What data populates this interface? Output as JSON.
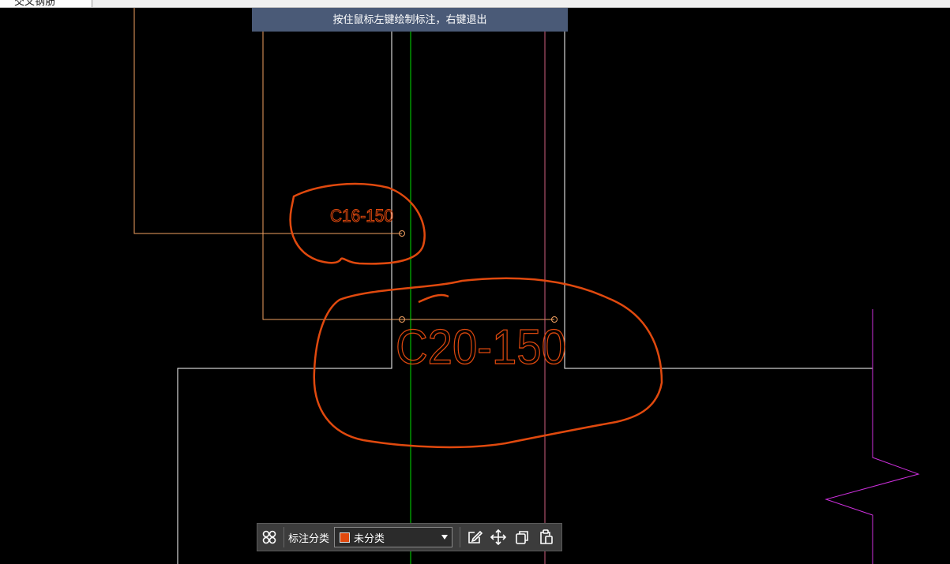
{
  "top_tab": {
    "label": "交叉钢筋"
  },
  "hint": {
    "text": "按住鼠标左键绘制标注，右键退出"
  },
  "annotations": {
    "small_label": "C16-150",
    "large_label": "C20-150"
  },
  "toolbar": {
    "category_label": "标注分类",
    "category_value": "未分类",
    "category_color": "#e0490e",
    "icons": [
      "grid-icon",
      "edit-icon",
      "move-icon",
      "copy-icon",
      "paste-icon"
    ]
  },
  "colors": {
    "background": "#000000",
    "annotation_red": "#e0490e",
    "wall_white": "#ffffff",
    "leader_orange": "#f0a060",
    "axis_green": "#00e000",
    "axis_pink": "#d06080",
    "break_magenta": "#d030e0"
  }
}
